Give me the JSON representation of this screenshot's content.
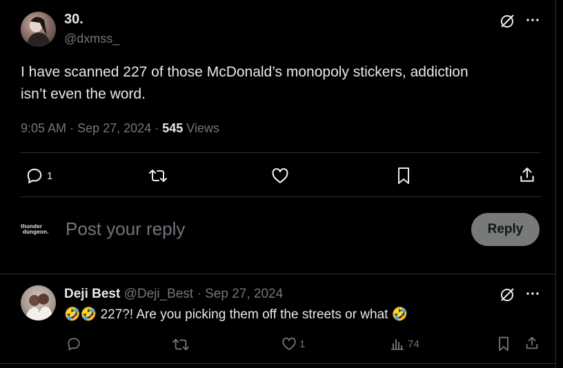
{
  "tweet": {
    "display_name": "30.",
    "handle": "@dxmss_",
    "text_line1": "I have scanned 227 of those McDonald’s monopoly stickers, addiction",
    "text_line2": "isn’t even the word.",
    "time": "9:05 AM",
    "sep1": "·",
    "date": "Sep 27, 2024",
    "sep2": "·",
    "views_count": "545",
    "views_label": "Views",
    "reply_count": "1",
    "icons": [
      "grok-icon",
      "more-icon",
      "reply-icon",
      "retweet-icon",
      "like-icon",
      "bookmark-icon",
      "share-icon"
    ]
  },
  "composer": {
    "avatar_line1": "thunder",
    "avatar_line2": "dungeon.",
    "placeholder": "Post your reply",
    "reply_button": "Reply"
  },
  "reply": {
    "display_name": "Deji Best",
    "handle": "@Deji_Best",
    "sep": "·",
    "date": "Sep 27, 2024",
    "emoji_prefix": "🤣🤣",
    "text": "227?! Are you picking them off the streets or what",
    "emoji_suffix": "🤣",
    "like_count": "1",
    "views_count": "74"
  },
  "colors": {
    "background": "#000000",
    "text": "#e7e9ea",
    "muted": "#71767b",
    "divider": "#2f3336",
    "reply_button": "#787a7a"
  }
}
